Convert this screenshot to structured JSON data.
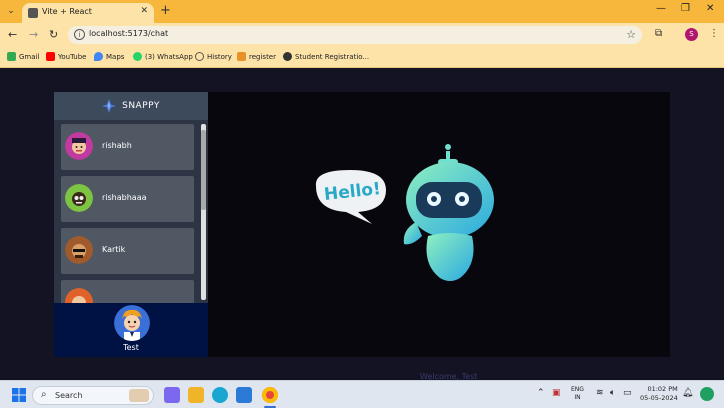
{
  "browser": {
    "tab_title": "Vite + React",
    "url": "localhost:5173/chat",
    "profile_initial": "S",
    "bookmarks": [
      {
        "label": "Gmail",
        "color": "#34a853"
      },
      {
        "label": "YouTube",
        "color": "#ff0000"
      },
      {
        "label": "Maps",
        "color": "#4285f4"
      },
      {
        "label": "(3) WhatsApp",
        "color": "#25d366"
      },
      {
        "label": "History",
        "color": "#555555"
      },
      {
        "label": "register",
        "color": "#e8902a"
      },
      {
        "label": "Student Registratio...",
        "color": "#333333"
      }
    ]
  },
  "app": {
    "brand": "SNAPPY",
    "contacts": [
      {
        "name": "rishabh",
        "avatar_color": "#c03aa0"
      },
      {
        "name": "rishabhaaa",
        "avatar_color": "#7dc443"
      },
      {
        "name": "Kartik",
        "avatar_color": "#a05a2c"
      },
      {
        "name": "",
        "avatar_color": "#e0622a"
      }
    ],
    "current_user": {
      "name": "Test"
    },
    "welcome": {
      "bubble": "Hello!",
      "partial_text": "Welcome, Test"
    }
  },
  "taskbar": {
    "search_placeholder": "Search",
    "lang_line1": "ENG",
    "lang_line2": "IN",
    "time": "01:02 PM",
    "date": "05-05-2024"
  },
  "colors": {
    "chrome_tab_bar": "#f6b73c",
    "chrome_toolbar": "#fde3a7",
    "page_background": "#131324",
    "sidebar_header": "#3d4a5c",
    "contact_card": "#4f5863",
    "current_user_bar": "#001243"
  }
}
